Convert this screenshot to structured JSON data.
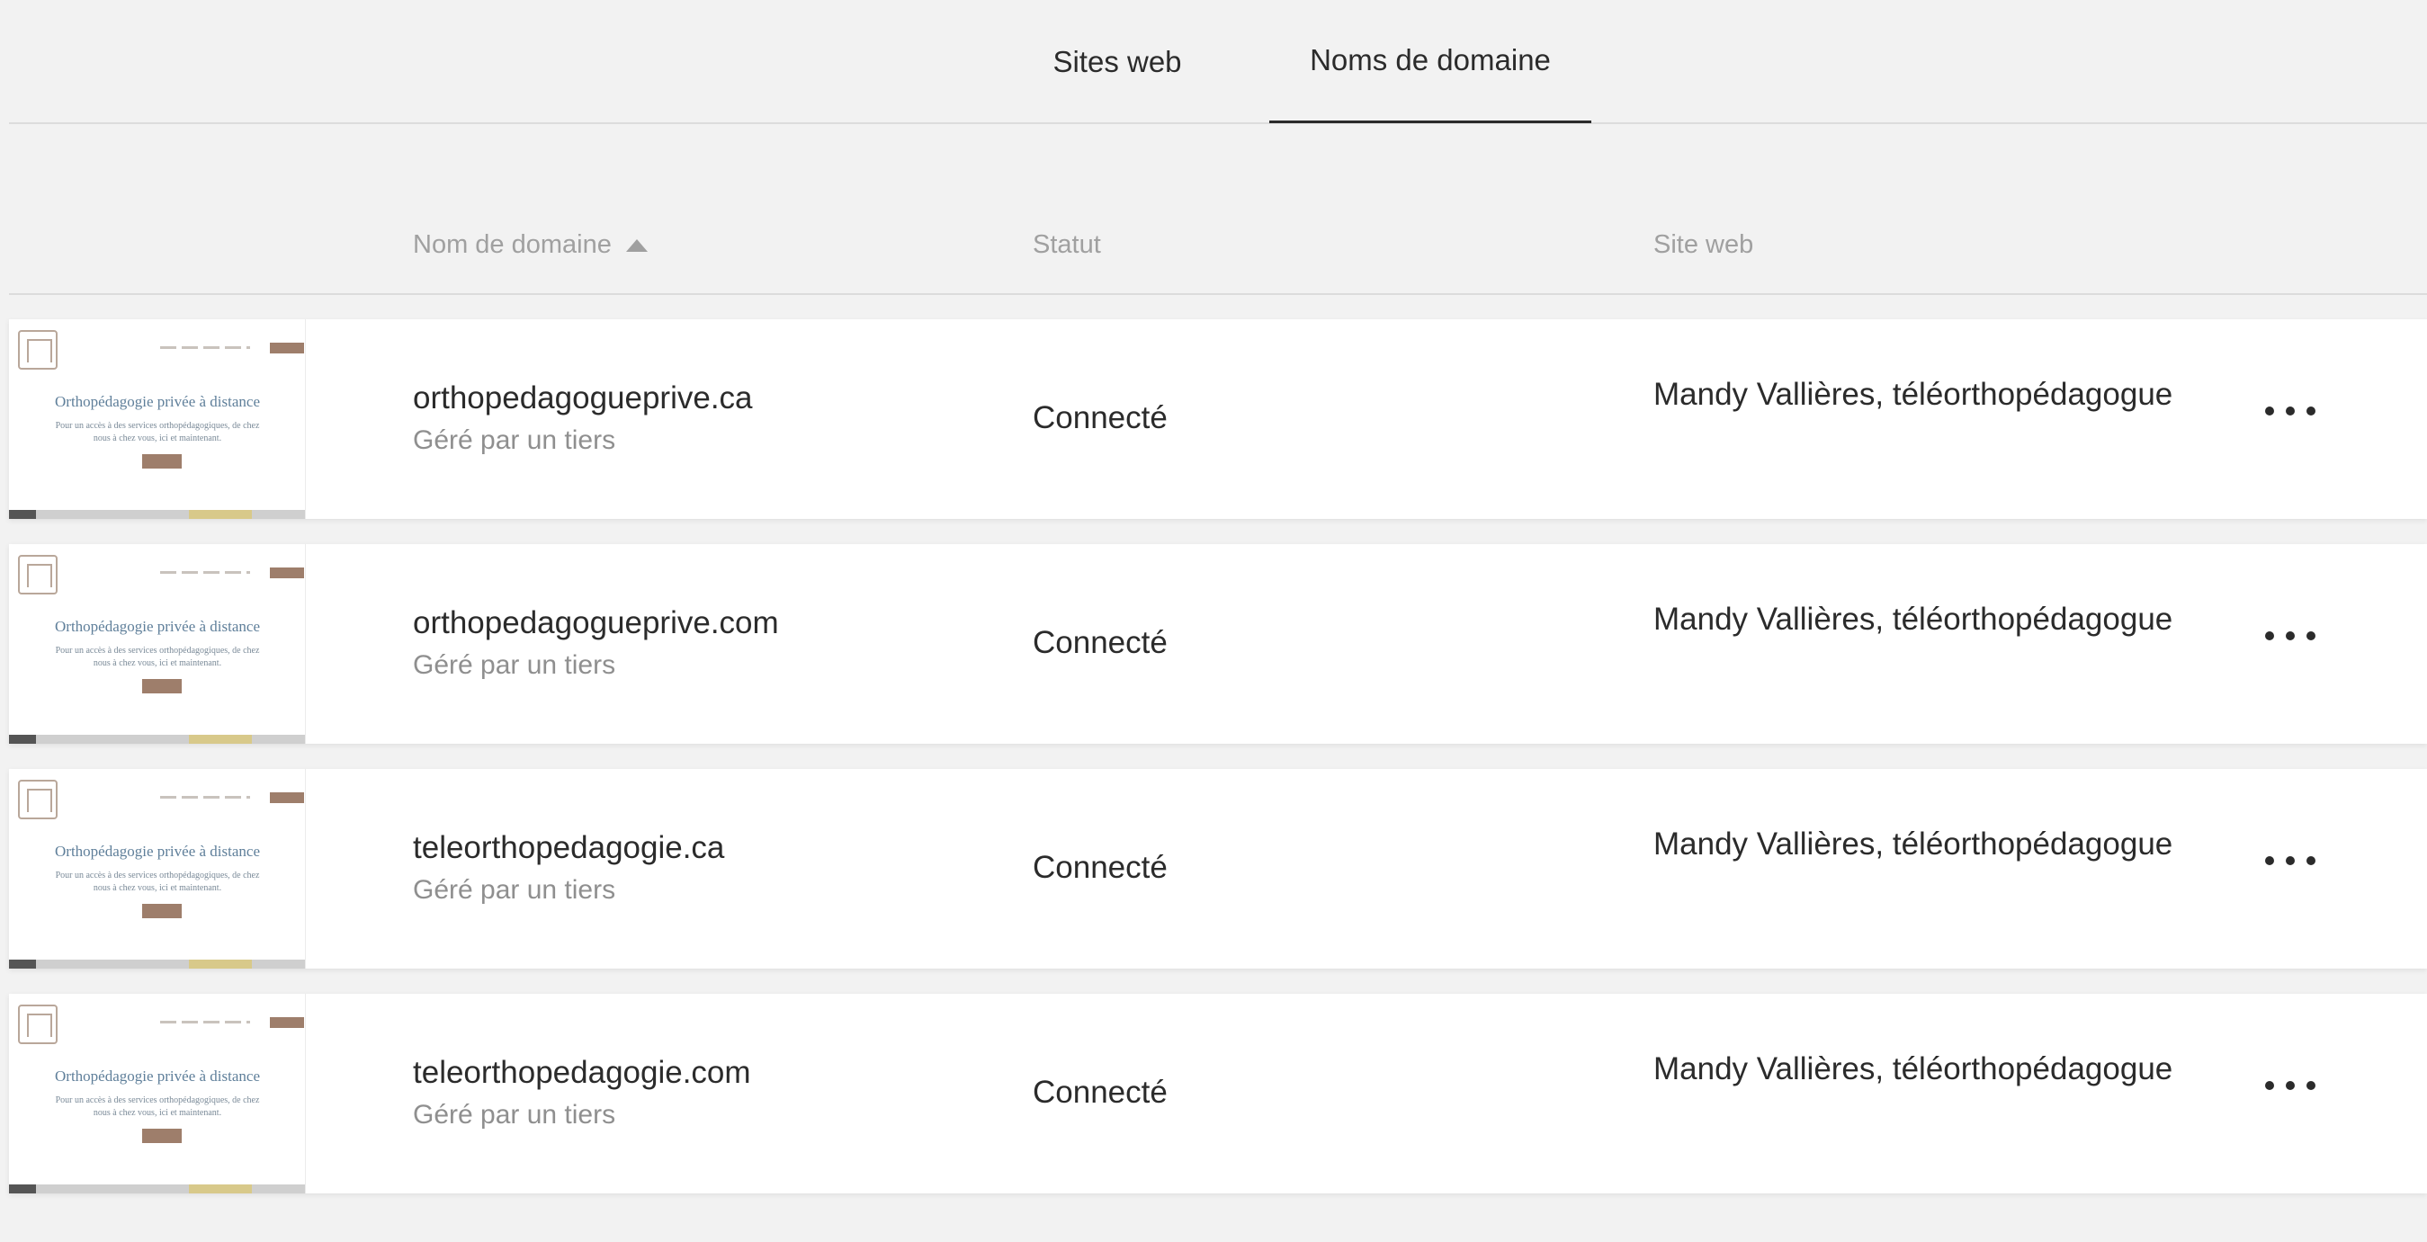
{
  "tabs": [
    {
      "label": "Sites web",
      "active": false
    },
    {
      "label": "Noms de domaine",
      "active": true
    }
  ],
  "table": {
    "headers": {
      "domain": "Nom de domaine",
      "status": "Statut",
      "site": "Site web"
    },
    "sort": {
      "column": "domain",
      "direction": "ascending"
    },
    "thumbnail": {
      "title": "Orthopédagogie privée à distance",
      "subtitle": "Pour un accès à des services orthopédagogiques, de chez nous à chez vous, ici et maintenant."
    },
    "rows": [
      {
        "domain": "orthopedagogueprive.ca",
        "managed": "Géré par un tiers",
        "status": "Connecté",
        "site": "Mandy Vallières, téléorthopédagogue"
      },
      {
        "domain": "orthopedagogueprive.com",
        "managed": "Géré par un tiers",
        "status": "Connecté",
        "site": "Mandy Vallières, téléorthopédagogue"
      },
      {
        "domain": "teleorthopedagogie.ca",
        "managed": "Géré par un tiers",
        "status": "Connecté",
        "site": "Mandy Vallières, téléorthopédagogue"
      },
      {
        "domain": "teleorthopedagogie.com",
        "managed": "Géré par un tiers",
        "status": "Connecté",
        "site": "Mandy Vallières, téléorthopédagogue"
      }
    ]
  },
  "icons": {
    "more": "more-horizontal-icon",
    "sort": "sort-ascending-icon"
  },
  "colors": {
    "background": "#f2f2f2",
    "row": "#ffffff",
    "text": "#2b2b2b",
    "muted": "#8f8f8f",
    "accent": "#9e7e6b"
  }
}
